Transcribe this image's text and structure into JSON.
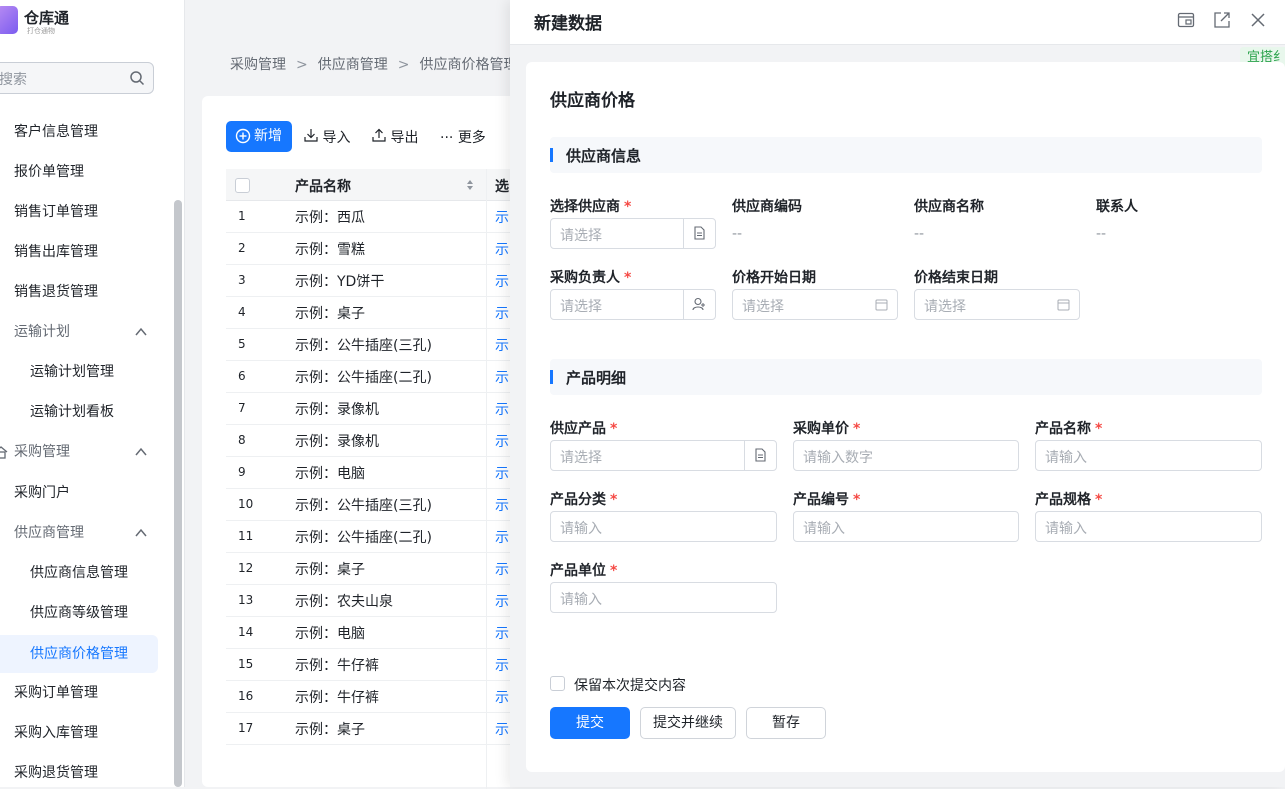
{
  "app": {
    "name": "仓库通",
    "subtitle": "打仓通物"
  },
  "sidebar": {
    "search_placeholder": "搜索",
    "items": [
      {
        "label": "客户信息管理",
        "level": 1
      },
      {
        "label": "报价单管理",
        "level": 1
      },
      {
        "label": "销售订单管理",
        "level": 1
      },
      {
        "label": "销售出库管理",
        "level": 1
      },
      {
        "label": "销售退货管理",
        "level": 1
      },
      {
        "label": "运输计划",
        "level": 1,
        "expanded": true
      },
      {
        "label": "运输计划管理",
        "level": 2
      },
      {
        "label": "运输计划看板",
        "level": 2
      },
      {
        "label": "采购管理",
        "level": 0,
        "expanded": true
      },
      {
        "label": "采购门户",
        "level": 1
      },
      {
        "label": "供应商管理",
        "level": 1,
        "expanded": true
      },
      {
        "label": "供应商信息管理",
        "level": 2
      },
      {
        "label": "供应商等级管理",
        "level": 2
      },
      {
        "label": "供应商价格管理",
        "level": 2,
        "active": true
      },
      {
        "label": "采购订单管理",
        "level": 1
      },
      {
        "label": "采购入库管理",
        "level": 1
      },
      {
        "label": "采购退货管理",
        "level": 1
      }
    ]
  },
  "breadcrumb": [
    "采购管理",
    "供应商管理",
    "供应商价格管理"
  ],
  "toolbar": {
    "new": "新增",
    "import": "导入",
    "export": "导出",
    "more": "更多"
  },
  "table": {
    "columns": [
      "产品名称",
      "选"
    ],
    "rows": [
      {
        "no": "1",
        "name": "示例：西瓜",
        "link": "示"
      },
      {
        "no": "2",
        "name": "示例：雪糕",
        "link": "示"
      },
      {
        "no": "3",
        "name": "示例：YD饼干",
        "link": "示"
      },
      {
        "no": "4",
        "name": "示例：桌子",
        "link": "示"
      },
      {
        "no": "5",
        "name": "示例：公牛插座(三孔)",
        "link": "示"
      },
      {
        "no": "6",
        "name": "示例：公牛插座(二孔)",
        "link": "示"
      },
      {
        "no": "7",
        "name": "示例：录像机",
        "link": "示"
      },
      {
        "no": "8",
        "name": "示例：录像机",
        "link": "示"
      },
      {
        "no": "9",
        "name": "示例：电脑",
        "link": "示"
      },
      {
        "no": "10",
        "name": "示例：公牛插座(三孔)",
        "link": "示"
      },
      {
        "no": "11",
        "name": "示例：公牛插座(二孔)",
        "link": "示"
      },
      {
        "no": "12",
        "name": "示例：桌子",
        "link": "示"
      },
      {
        "no": "13",
        "name": "示例：农夫山泉",
        "link": "示"
      },
      {
        "no": "14",
        "name": "示例：电脑",
        "link": "示"
      },
      {
        "no": "15",
        "name": "示例：牛仔裤",
        "link": "示"
      },
      {
        "no": "16",
        "name": "示例：牛仔裤",
        "link": "示"
      },
      {
        "no": "17",
        "name": "示例：桌子",
        "link": "示"
      }
    ]
  },
  "drawer": {
    "title": "新建数据",
    "tag": "宜搭纟",
    "form_title": "供应商价格",
    "section1": "供应商信息",
    "section2": "产品明细",
    "fields": {
      "supplier": {
        "label": "选择供应商",
        "placeholder": "请选择"
      },
      "supplier_code": {
        "label": "供应商编码",
        "value": "--"
      },
      "supplier_name": {
        "label": "供应商名称",
        "value": "--"
      },
      "contact": {
        "label": "联系人",
        "value": "--"
      },
      "buyer": {
        "label": "采购负责人",
        "placeholder": "请选择"
      },
      "start_date": {
        "label": "价格开始日期",
        "placeholder": "请选择"
      },
      "end_date": {
        "label": "价格结束日期",
        "placeholder": "请选择"
      },
      "product": {
        "label": "供应产品",
        "placeholder": "请选择"
      },
      "unit_price": {
        "label": "采购单价",
        "placeholder": "请输入数字"
      },
      "product_name": {
        "label": "产品名称",
        "placeholder": "请输入"
      },
      "category": {
        "label": "产品分类",
        "placeholder": "请输入"
      },
      "product_code": {
        "label": "产品编号",
        "placeholder": "请输入"
      },
      "spec": {
        "label": "产品规格",
        "placeholder": "请输入"
      },
      "unit": {
        "label": "产品单位",
        "placeholder": "请输入"
      }
    },
    "required_mark": "*",
    "keep_label": "保留本次提交内容",
    "buttons": {
      "submit": "提交",
      "submit_continue": "提交并继续",
      "save_draft": "暂存"
    }
  },
  "colors": {
    "accent": "#1677ff",
    "required": "#f54a45",
    "tag_green": "#2ba34c"
  }
}
